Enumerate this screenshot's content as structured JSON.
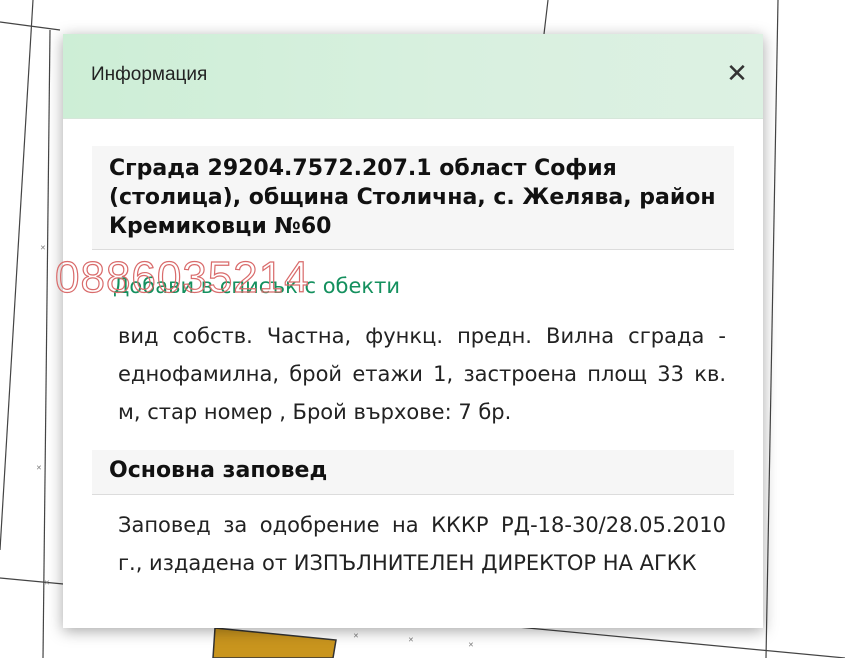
{
  "dialog": {
    "title": "Информация",
    "close_label": "✕"
  },
  "building": {
    "heading": "Сграда 29204.7572.207.1 област София (столица), община Столична, с. Желява, район Кремиковци №60",
    "add_link": "Добави в списък с обекти",
    "properties": "вид собств. Частна, функц. предн. Вилна сграда - еднофамилна, брой етажи 1, застроена площ 33 кв. м, стар номер , Брой върхове: 7 бр."
  },
  "order": {
    "heading": "Основна заповед",
    "text": "Заповед за одобрение на КККР РД-18-30/28.05.2010 г., издадена от ИЗПЪЛНИТЕЛЕН ДИРЕКТОР НА АГКК"
  },
  "watermark": "0886035214",
  "colors": {
    "header_bg": "#cdeed6",
    "link": "#14905e",
    "watermark": "#d96b6b",
    "parcel_fill": "#c9951e"
  }
}
